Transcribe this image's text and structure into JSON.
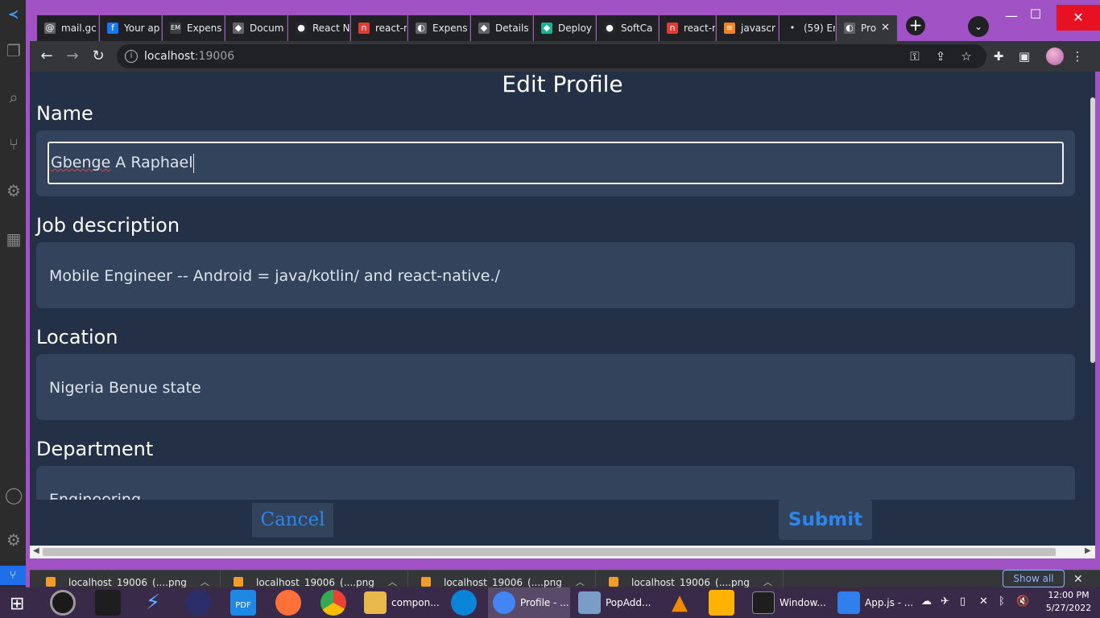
{
  "browser": {
    "tabs": [
      {
        "label": "mail.gc",
        "color": "#5f6368",
        "glyph": "@"
      },
      {
        "label": "Your ap",
        "color": "#1877f2",
        "glyph": "f"
      },
      {
        "label": "Expens",
        "color": "#3c4043",
        "glyph": "EM"
      },
      {
        "label": "Docum",
        "color": "#5f6368",
        "glyph": "◆"
      },
      {
        "label": "React N",
        "color": "#24292f",
        "glyph": "●"
      },
      {
        "label": "react-r",
        "color": "#e53935",
        "glyph": "n"
      },
      {
        "label": "Expens",
        "color": "#5f6368",
        "glyph": "◐"
      },
      {
        "label": "Details",
        "color": "#5f6368",
        "glyph": "◆"
      },
      {
        "label": "Deploy",
        "color": "#19b394",
        "glyph": "◆"
      },
      {
        "label": "SoftCa",
        "color": "#24292f",
        "glyph": "●"
      },
      {
        "label": "react-r",
        "color": "#e53935",
        "glyph": "n"
      },
      {
        "label": "javascr",
        "color": "#f48024",
        "glyph": "≡"
      },
      {
        "label": "(59) En",
        "color": "#202124",
        "glyph": "•"
      },
      {
        "label": "Pro",
        "color": "#5f6368",
        "glyph": "◐"
      }
    ],
    "address_host": "localhost",
    "address_port": ":19006",
    "new_tab": "+",
    "tab_search": "⌄",
    "minimize": "—",
    "maximize": "☐",
    "close": "✕"
  },
  "page": {
    "title": "Edit Profile",
    "fields": [
      {
        "label": "Name",
        "value_spell": "Gbenge",
        "value_rest": " A Raphael"
      },
      {
        "label": "Job description",
        "value": "Mobile Engineer -- Android = java/kotlin/ and react-native./"
      },
      {
        "label": "Location",
        "value": "Nigeria Benue state"
      },
      {
        "label": "Department",
        "value": "Engineering"
      }
    ],
    "cancel": "Cancel",
    "submit": "Submit"
  },
  "downloads": {
    "items": [
      "localhost_19006_(....png",
      "localhost_19006_(....png",
      "localhost_19006_(....png",
      "localhost_19006_(....png"
    ],
    "show_all": "Show all"
  },
  "taskbar": {
    "buttons": [
      {
        "label": "compon...",
        "color": "#e8b84a"
      },
      {
        "label": "Profile - ...",
        "color": "#4285f4"
      },
      {
        "label": "PopAdd...",
        "color": "#7a9cc6"
      },
      {
        "label": "Window...",
        "color": "#1e1e1e"
      },
      {
        "label": "App.js - ...",
        "color": "#2f80ed"
      }
    ],
    "time": "12:00 PM",
    "date": "5/27/2022"
  }
}
